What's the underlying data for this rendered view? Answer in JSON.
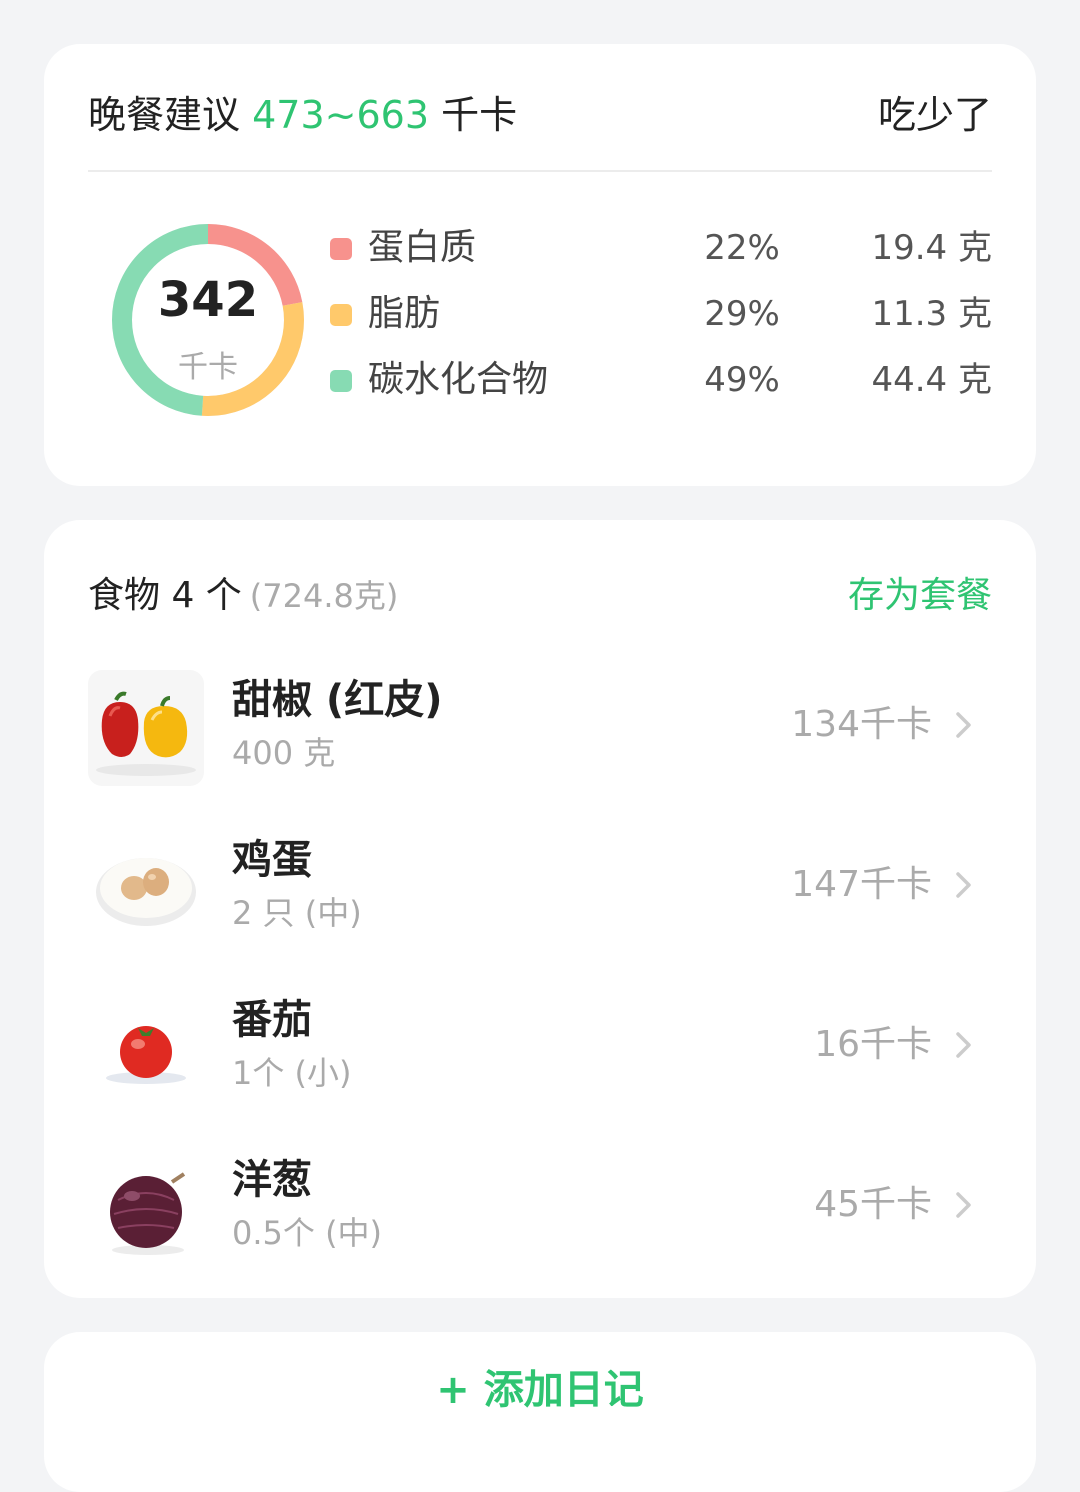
{
  "summary": {
    "title_prefix": "晚餐建议",
    "range": "473~663",
    "unit": "千卡",
    "action": "吃少了",
    "total_kcal": "342",
    "total_unit": "千卡",
    "macros": [
      {
        "name": "蛋白质",
        "percent": "22%",
        "grams": "19.4 克",
        "color": "#f7928d",
        "share": 0.22
      },
      {
        "name": "脂肪",
        "percent": "29%",
        "grams": "11.3 克",
        "color": "#ffc96b",
        "share": 0.29
      },
      {
        "name": "碳水化合物",
        "percent": "49%",
        "grams": "44.4 克",
        "color": "#87dbb3",
        "share": 0.49
      }
    ]
  },
  "foods": {
    "title": "食物 4 个",
    "total_weight": "(724.8克)",
    "save_label": "存为套餐",
    "items": [
      {
        "name": "甜椒 (红皮)",
        "amount": "400 克",
        "kcal": "134千卡",
        "icon": "bell-pepper-icon"
      },
      {
        "name": "鸡蛋",
        "amount": "2 只 (中)",
        "kcal": "147千卡",
        "icon": "egg-icon"
      },
      {
        "name": "番茄",
        "amount": "1个 (小)",
        "kcal": "16千卡",
        "icon": "tomato-icon"
      },
      {
        "name": "洋葱",
        "amount": "0.5个 (中)",
        "kcal": "45千卡",
        "icon": "onion-icon"
      }
    ]
  },
  "add_diary": {
    "label": "+ 添加日记"
  },
  "colors": {
    "accent": "#2fc472",
    "background": "#f3f4f6"
  }
}
